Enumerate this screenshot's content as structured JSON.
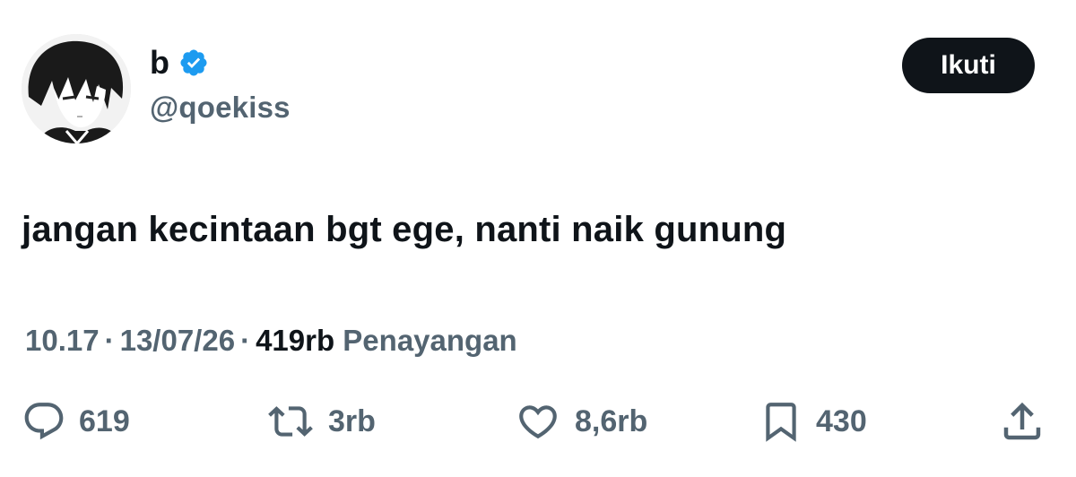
{
  "author": {
    "display_name": "b",
    "handle": "@qoekiss",
    "verified": true,
    "avatar_icon": "anime-character-avatar"
  },
  "follow_button": {
    "label": "Ikuti"
  },
  "tweet": {
    "text": "jangan kecintaan bgt ege, nanti naik gunung"
  },
  "meta": {
    "time": "10.17",
    "separator": "·",
    "date": "13/07/26",
    "views_count": "419rb",
    "views_label": "Penayangan"
  },
  "actions": {
    "replies": {
      "icon": "reply-icon",
      "count": "619"
    },
    "reposts": {
      "icon": "repost-icon",
      "count": "3rb"
    },
    "likes": {
      "icon": "heart-icon",
      "count": "8,6rb"
    },
    "bookmarks": {
      "icon": "bookmark-icon",
      "count": "430"
    },
    "share": {
      "icon": "share-icon"
    }
  },
  "colors": {
    "text_primary": "#0f1419",
    "text_secondary": "#536471",
    "verified_blue": "#1d9bf0",
    "button_bg": "#0f1419",
    "button_text": "#ffffff"
  }
}
